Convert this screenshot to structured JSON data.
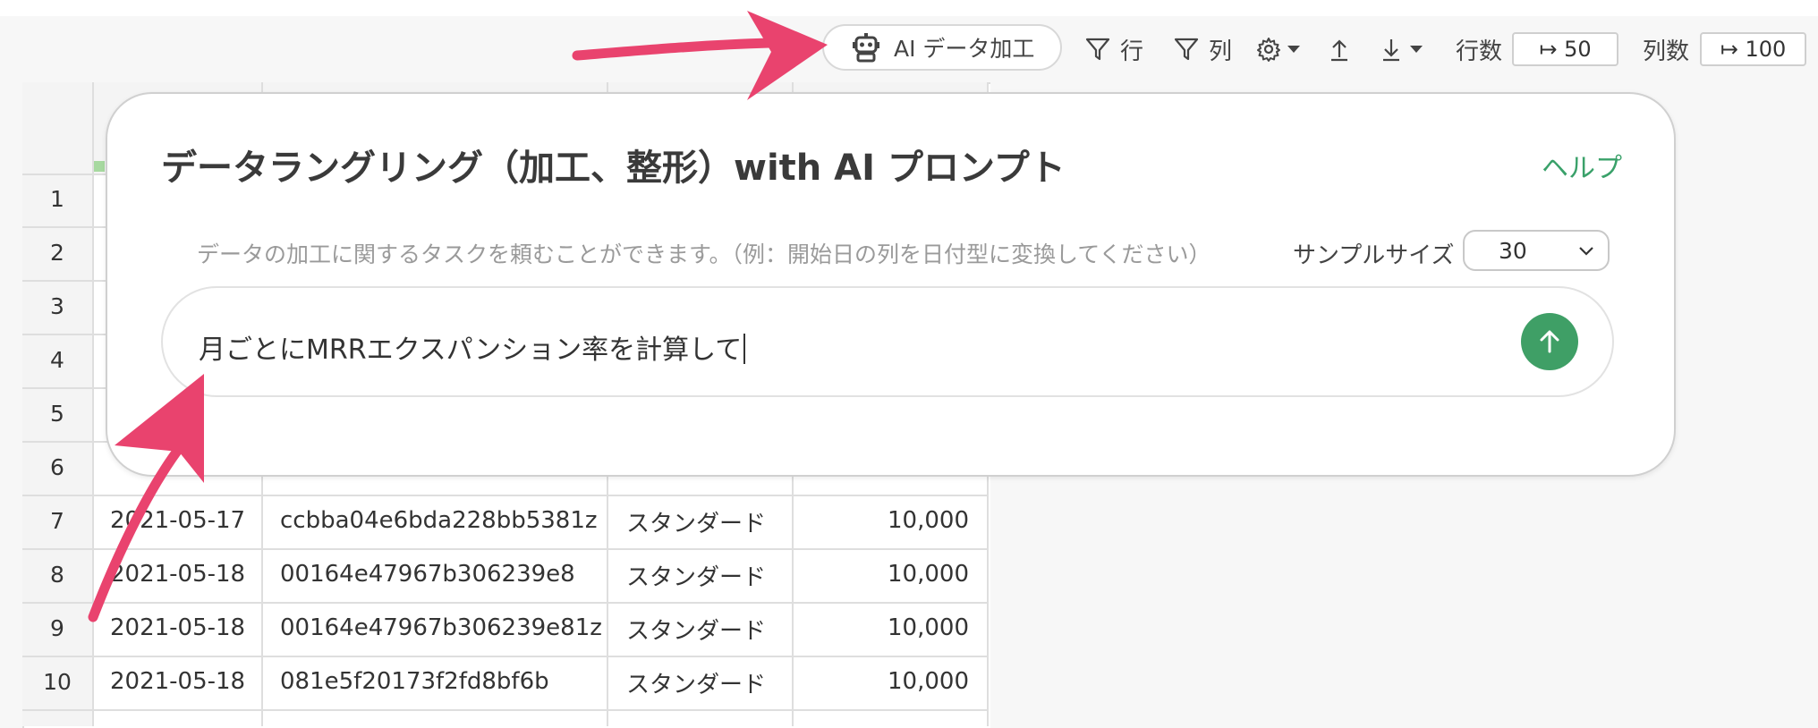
{
  "toolbar": {
    "ai_button_label": "AI データ加工",
    "filter_rows_label": "行",
    "filter_cols_label": "列",
    "row_count_label": "行数",
    "row_count_value": "↦ 50",
    "col_count_label": "列数",
    "col_count_value": "↦ 100"
  },
  "grid": {
    "row_numbers": [
      "1",
      "2",
      "3",
      "4",
      "5",
      "6",
      "7",
      "8",
      "9",
      "10"
    ],
    "rows": [
      {
        "date": "2021-05-17",
        "id": "ccbba04e6bda228bb5381z",
        "plan": "スタンダード",
        "amount": "10,000"
      },
      {
        "date": "2021-05-18",
        "id": "00164e47967b306239e8",
        "plan": "スタンダード",
        "amount": "10,000"
      },
      {
        "date": "2021-05-18",
        "id": "00164e47967b306239e81z",
        "plan": "スタンダード",
        "amount": "10,000"
      },
      {
        "date": "2021-05-18",
        "id": "081e5f20173f2fd8bf6b",
        "plan": "スタンダード",
        "amount": "10,000"
      }
    ]
  },
  "dialog": {
    "title": "データラングリング（加工、整形）with AI プロンプト",
    "help_label": "ヘルプ",
    "description": "データの加工に関するタスクを頼むことができます。（例：開始日の列を日付型に変換してください）",
    "sample_size_label": "サンプルサイズ",
    "sample_size_value": "30",
    "prompt_value": "月ごとにMRRエクスパンション率を計算して"
  },
  "colors": {
    "accent_green": "#3f9f66",
    "help_green": "#3aa16a",
    "arrow_pink": "#e9436e"
  },
  "icons": [
    "robot-icon",
    "filter-icon",
    "gear-icon",
    "upload-icon",
    "download-icon",
    "chevron-down-icon",
    "arrow-up-icon"
  ]
}
